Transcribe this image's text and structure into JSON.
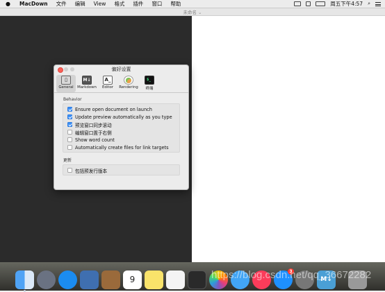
{
  "menubar": {
    "apple": "",
    "app_name": "MacDown",
    "items": [
      "文件",
      "编辑",
      "View",
      "格式",
      "插件",
      "窗口",
      "帮助"
    ],
    "clock": "周五下午4:57"
  },
  "window": {
    "title": "未命名 ⌄"
  },
  "prefs": {
    "title": "偏好设置",
    "toolbar": [
      {
        "label": "General",
        "glyph": "▯"
      },
      {
        "label": "Markdown",
        "glyph": "M↓"
      },
      {
        "label": "Editor",
        "glyph": "A_"
      },
      {
        "label": "Rendering",
        "glyph": ""
      },
      {
        "label": "终端",
        "glyph": "$_"
      }
    ],
    "behavior": {
      "label": "Behavior",
      "options": [
        {
          "text": "Ensure open document on launch",
          "checked": true
        },
        {
          "text": "Update preview automatically as you type",
          "checked": true
        },
        {
          "text": "预览窗口同步滚动",
          "checked": true
        },
        {
          "text": "编辑窗口置于右侧",
          "checked": false
        },
        {
          "text": "Show word count",
          "checked": false
        },
        {
          "text": "Automatically create files for link targets",
          "checked": false
        }
      ]
    },
    "update": {
      "label": "更新",
      "options": [
        {
          "text": "包括预发行版本",
          "checked": false
        }
      ]
    }
  },
  "dock": {
    "calendar_day": "9",
    "appstore_badge": "3",
    "macdown_glyph": "M↓",
    "watermark": "https://blog.csdn.net/qq_36672282"
  },
  "colors": {
    "editor_bg": "#2b2b2b",
    "checkbox_accent": "#3b8ff6"
  }
}
